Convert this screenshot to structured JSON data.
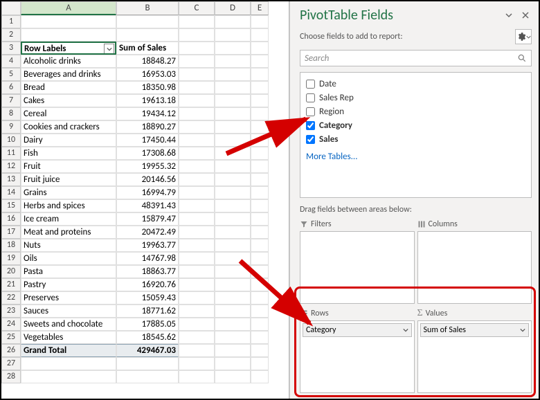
{
  "chart_data": {
    "type": "table",
    "categories": [
      "Alcoholic drinks",
      "Beverages and drinks",
      "Bread",
      "Cakes",
      "Cereal",
      "Cookies and crackers",
      "Dairy",
      "Fish",
      "Fruit",
      "Fruit juice",
      "Grains",
      "Herbs and spices",
      "Ice cream",
      "Meat and proteins",
      "Nuts",
      "Oils",
      "Pasta",
      "Pastry",
      "Preserves",
      "Sauces",
      "Sweets and chocolate",
      "Vegetables"
    ],
    "values": [
      18848.27,
      16953.03,
      18350.98,
      19613.18,
      19434.12,
      18890.27,
      17450.44,
      17308.68,
      19955.32,
      20146.56,
      16994.79,
      48391.43,
      15879.47,
      20472.49,
      19963.77,
      14767.98,
      18863.77,
      16920.76,
      15059.43,
      18771.62,
      17885.05,
      18545.62
    ],
    "grand_total": 429467.03,
    "row_label_header": "Row Labels",
    "value_header": "Sum of Sales"
  },
  "columns": [
    "A",
    "B",
    "C",
    "D",
    "E"
  ],
  "rowHeaders": [
    "1",
    "2",
    "3",
    "4",
    "5",
    "6",
    "7",
    "8",
    "9",
    "10",
    "11",
    "12",
    "13",
    "14",
    "15",
    "16",
    "17",
    "18",
    "19",
    "20",
    "21",
    "22",
    "23",
    "24",
    "25",
    "26",
    "27",
    "28"
  ],
  "pivot": {
    "rowLabelsHeader": "Row Labels",
    "valuesHeader": "Sum of Sales",
    "rows": [
      {
        "label": "Alcoholic drinks",
        "value": "18848.27"
      },
      {
        "label": "Beverages and drinks",
        "value": "16953.03"
      },
      {
        "label": "Bread",
        "value": "18350.98"
      },
      {
        "label": "Cakes",
        "value": "19613.18"
      },
      {
        "label": "Cereal",
        "value": "19434.12"
      },
      {
        "label": "Cookies and crackers",
        "value": "18890.27"
      },
      {
        "label": "Dairy",
        "value": "17450.44"
      },
      {
        "label": "Fish",
        "value": "17308.68"
      },
      {
        "label": "Fruit",
        "value": "19955.32"
      },
      {
        "label": "Fruit juice",
        "value": "20146.56"
      },
      {
        "label": "Grains",
        "value": "16994.79"
      },
      {
        "label": "Herbs and spices",
        "value": "48391.43"
      },
      {
        "label": "Ice cream",
        "value": "15879.47"
      },
      {
        "label": "Meat and proteins",
        "value": "20472.49"
      },
      {
        "label": "Nuts",
        "value": "19963.77"
      },
      {
        "label": "Oils",
        "value": "14767.98"
      },
      {
        "label": "Pasta",
        "value": "18863.77"
      },
      {
        "label": "Pastry",
        "value": "16920.76"
      },
      {
        "label": "Preserves",
        "value": "15059.43"
      },
      {
        "label": "Sauces",
        "value": "18771.62"
      },
      {
        "label": "Sweets and chocolate",
        "value": "17885.05"
      },
      {
        "label": "Vegetables",
        "value": "18545.62"
      }
    ],
    "grandTotalLabel": "Grand Total",
    "grandTotalValue": "429467.03"
  },
  "pane": {
    "title": "PivotTable Fields",
    "choose": "Choose fields to add to report:",
    "searchPlaceholder": "Search",
    "fields": [
      {
        "name": "Date",
        "checked": false
      },
      {
        "name": "Sales Rep",
        "checked": false
      },
      {
        "name": "Region",
        "checked": false
      },
      {
        "name": "Category",
        "checked": true
      },
      {
        "name": "Sales",
        "checked": true
      }
    ],
    "moreTables": "More Tables...",
    "dragText": "Drag fields between areas below:",
    "areas": {
      "filters": "Filters",
      "columns": "Columns",
      "rows": "Rows",
      "values": "Values",
      "rowChip": "Category",
      "valueChip": "Sum of Sales"
    }
  }
}
